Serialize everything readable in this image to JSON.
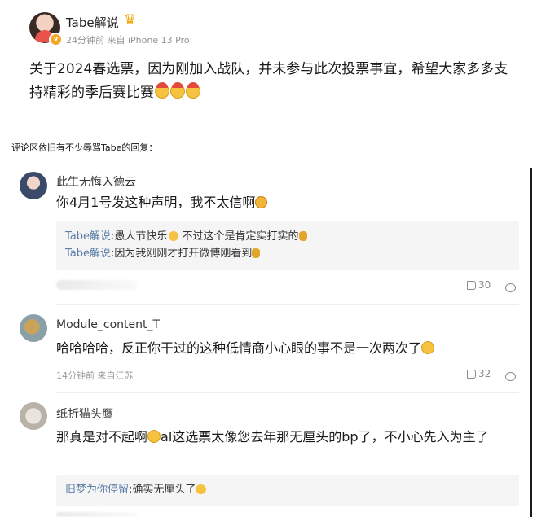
{
  "post": {
    "author": "Tabe解说",
    "meta": "24分钟前 来自 iPhone 13 Pro",
    "text": "关于2024春选票，因为刚加入战队，并未参与此次投票事宜，希望大家多多支持精彩的季后赛比赛"
  },
  "section_label": "评论区依旧有不少辱骂Tabe的回复：",
  "comments": [
    {
      "name": "此生无悔入德云",
      "text": "你4月1号发这种声明，我不太信啊",
      "replies": [
        {
          "name": "Tabe解说",
          "text": ":愚人节快乐",
          "text2": " 不过这个是肯定实打实的"
        },
        {
          "name": "Tabe解说",
          "text": ":因为我刚刚才打开微博刚看到"
        }
      ],
      "likes": "30"
    },
    {
      "name": "Module_content_T",
      "text": "哈哈哈哈，反正你干过的这种低情商小心眼的事不是一次两次了",
      "meta": "14分钟前 来自江苏",
      "likes": "32"
    },
    {
      "name": "纸折猫头鹰",
      "text": "那真是对不起啊",
      "text2": "al这选票太像您去年那无厘头的bp了，不小心先入为主了",
      "replies": [
        {
          "name": "旧梦为你停留",
          "text": ":确实无厘头了"
        }
      ]
    }
  ],
  "colors": {
    "reply_name": "#5b7ea7",
    "accent": "#f5a623"
  }
}
